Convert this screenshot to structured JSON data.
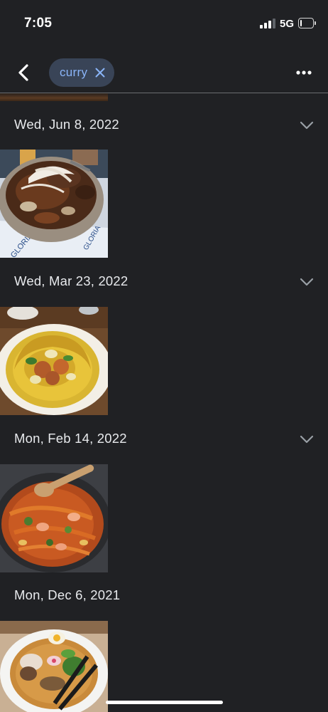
{
  "status_bar": {
    "time": "7:05",
    "network": "5G",
    "signal_bars": 3,
    "battery_level": 0.18
  },
  "app_bar": {
    "back_icon": "chevron-left-icon",
    "search_chip": {
      "label": "curry",
      "clear_icon": "close-icon"
    },
    "more_icon": "more-horizontal-icon"
  },
  "colors": {
    "background": "#202124",
    "chip_background": "#394457",
    "chip_text": "#8ab4f8",
    "text": "#e8eaed",
    "chevron": "#9aa0a6"
  },
  "sections": [
    {
      "date": "Wed, Jun 8, 2022",
      "expandable": true,
      "photo": "beef-stew-bowl"
    },
    {
      "date": "Wed, Mar 23, 2022",
      "expandable": true,
      "photo": "yellow-curry-plate"
    },
    {
      "date": "Mon, Feb 14, 2022",
      "expandable": true,
      "photo": "stir-fry-wok"
    },
    {
      "date": "Mon, Dec 6, 2021",
      "expandable": false,
      "photo": "ramen-bowl"
    }
  ]
}
